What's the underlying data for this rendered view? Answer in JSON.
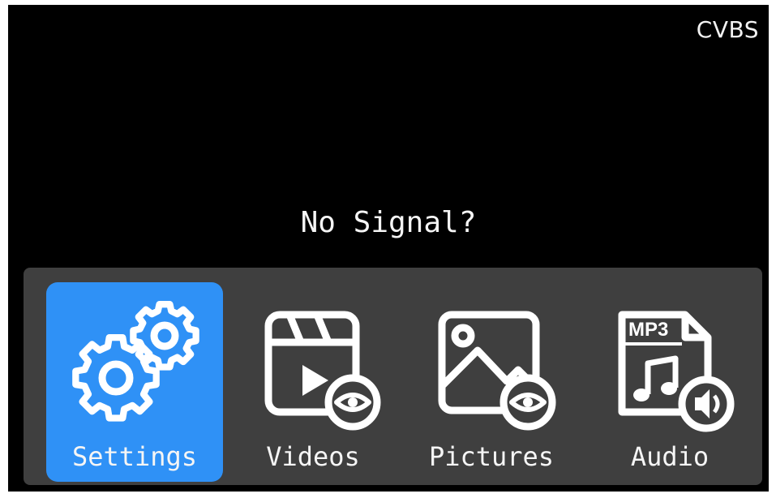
{
  "screen": {
    "source_label": "CVBS",
    "status_message": "No Signal?"
  },
  "menu": {
    "items": [
      {
        "label": "Settings",
        "icon": "gears-icon",
        "selected": true
      },
      {
        "label": "Videos",
        "icon": "video-clapper-eye-icon",
        "selected": false
      },
      {
        "label": "Pictures",
        "icon": "picture-eye-icon",
        "selected": false
      },
      {
        "label": "Audio",
        "icon": "mp3-audio-icon",
        "selected": false
      },
      {
        "label": "MP3",
        "icon": "mp3-file-badge",
        "selected": false
      }
    ]
  },
  "colors": {
    "screen_background": "#000000",
    "menu_background": "#3f3f3f",
    "selected_accent": "#2f91f6",
    "text": "#f5f5f5"
  }
}
